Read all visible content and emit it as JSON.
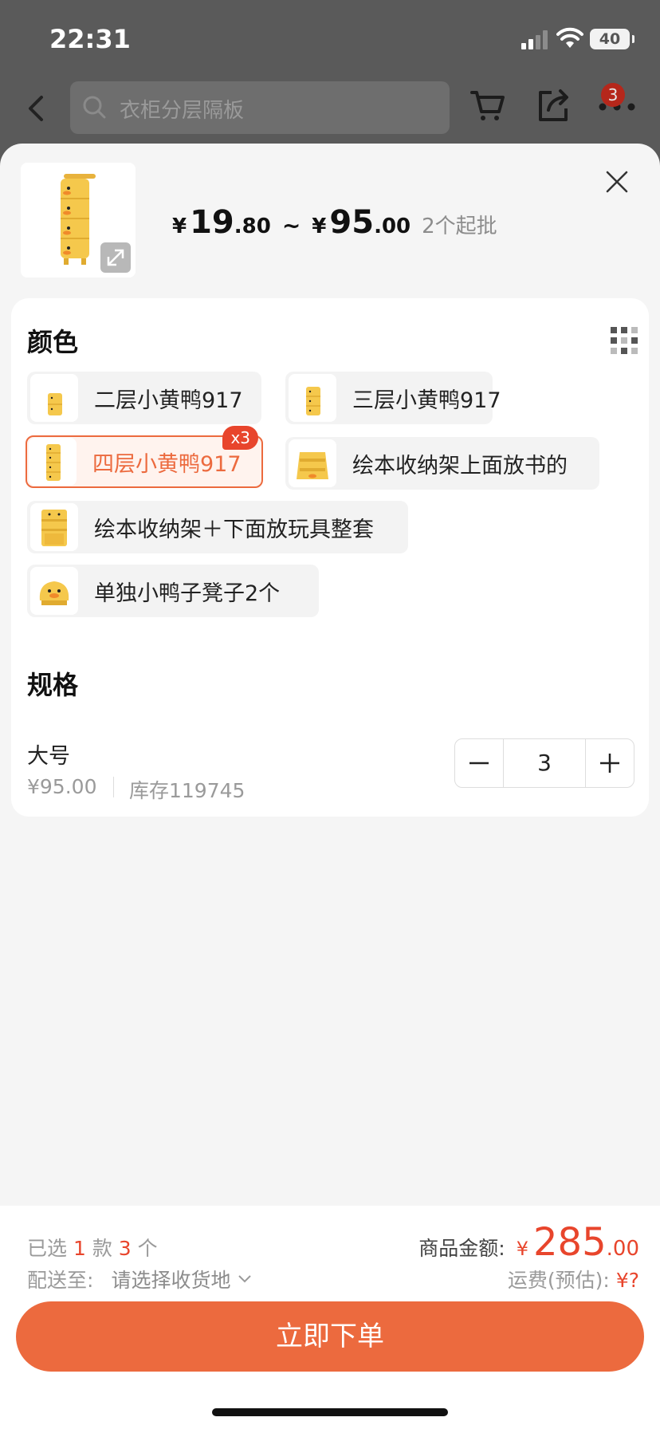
{
  "status_bar": {
    "time": "22:31",
    "battery": "40"
  },
  "top_nav": {
    "search_placeholder": "衣柜分层隔板",
    "more_badge": "3"
  },
  "product": {
    "price_min_int": "19",
    "price_min_dec": ".80",
    "price_max_int": "95",
    "price_max_dec": ".00",
    "currency": "¥",
    "tilde": "~",
    "min_order": "2个起批"
  },
  "color_section": {
    "title": "颜色",
    "options": [
      {
        "label": "二层小黄鸭917",
        "selected": false,
        "badge": ""
      },
      {
        "label": "三层小黄鸭917",
        "selected": false,
        "badge": ""
      },
      {
        "label": "四层小黄鸭917",
        "selected": true,
        "badge": "x3"
      },
      {
        "label": "绘本收纳架上面放书的",
        "selected": false,
        "badge": ""
      },
      {
        "label": "绘本收纳架＋下面放玩具整套",
        "selected": false,
        "badge": ""
      },
      {
        "label": "单独小鸭子凳子2个",
        "selected": false,
        "badge": ""
      }
    ]
  },
  "spec_section": {
    "title": "规格",
    "name": "大号",
    "price": "¥95.00",
    "stock": "库存119745",
    "quantity": "3"
  },
  "footer": {
    "selected_prefix": "已选",
    "selected_styles": "1",
    "styles_unit": "款",
    "selected_count": "3",
    "count_unit": "个",
    "deliver_label": "配送至:",
    "deliver_value": "请选择收货地",
    "amount_label": "商品金额:",
    "amount_currency": "¥",
    "amount_int": "285",
    "amount_dec": ".00",
    "shipping_label": "运费(预估):",
    "shipping_value": "¥?",
    "order_button": "立即下单"
  },
  "colors": {
    "accent": "#ec6a3e",
    "price_red": "#e8452c",
    "duck_yellow": "#f5c84c"
  }
}
